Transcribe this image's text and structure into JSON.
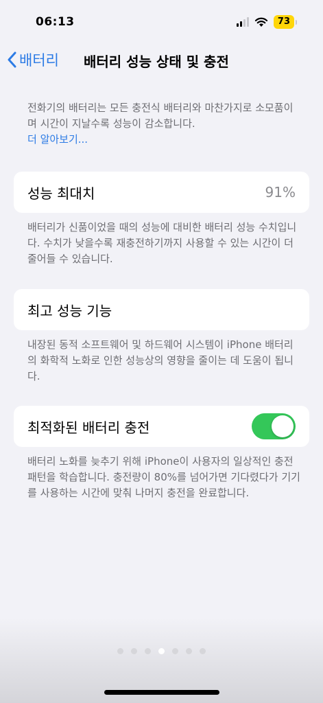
{
  "status_bar": {
    "time": "06:13",
    "battery": "73"
  },
  "nav": {
    "back_label": "배터리",
    "title": "배터리 성능 상태 및 충전"
  },
  "intro": {
    "text": "전화기의 배터리는 모든 충전식 배터리와 마찬가지로 소모품이며 시간이 지날수록 성능이 감소합니다.",
    "learn_more": "더 알아보기..."
  },
  "max_capacity": {
    "label": "성능 최대치",
    "value": "91%",
    "footnote": "배터리가 신품이었을 때의 성능에 대비한 배터리 성능 수치입니다. 수치가 낮을수록 재충전하기까지 사용할 수 있는 시간이 더 줄어들 수 있습니다."
  },
  "peak_performance": {
    "label": "최고 성능 기능",
    "footnote": "내장된 동적 소프트웨어 및 하드웨어 시스템이 iPhone 배터리의 화학적 노화로 인한 성능상의 영향을 줄이는 데 도움이 됩니다."
  },
  "optimized_charging": {
    "label": "최적화된 배터리 충전",
    "enabled": true,
    "footnote": "배터리 노화를 늦추기 위해 iPhone이 사용자의 일상적인 충전 패턴을 학습합니다. 충전량이 80%를 넘어가면 기다렸다가 기기를 사용하는 시간에 맞춰 나머지 충전을 완료합니다."
  },
  "colors": {
    "accent": "#2c7be5",
    "toggle_on": "#34c759",
    "background": "#f2f2f7",
    "battery_badge": "#ffd60a"
  },
  "page_indicator": {
    "count": 7,
    "active_index": 3
  }
}
